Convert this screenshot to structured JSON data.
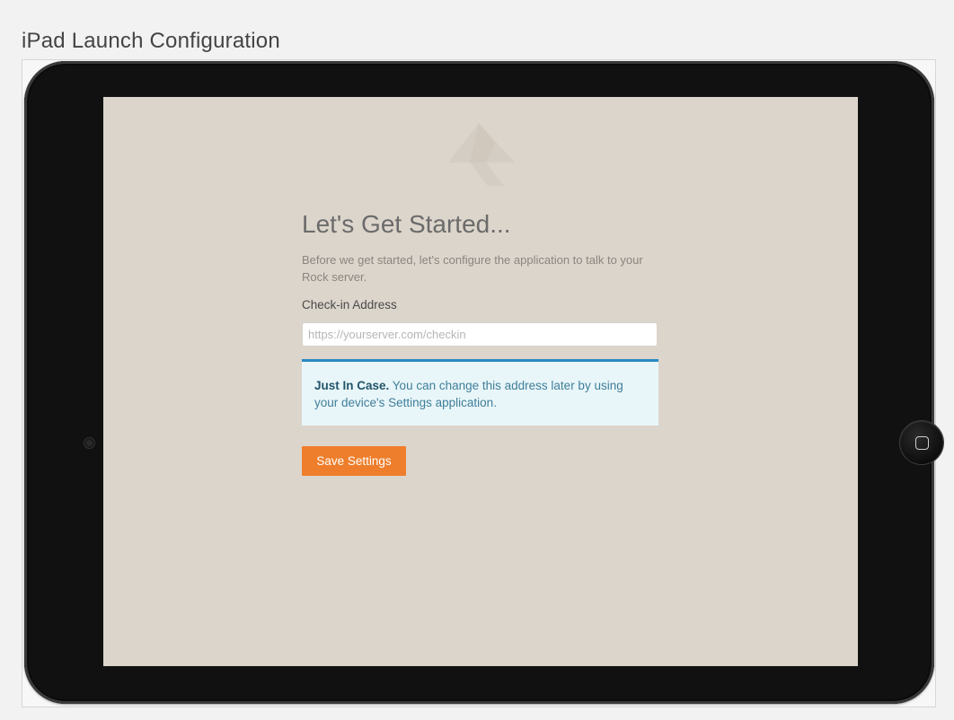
{
  "caption": "iPad Launch Configuration",
  "screen": {
    "logo_icon": "rock-logo-icon",
    "heading": "Let's Get Started...",
    "intro": "Before we get started, let's configure the application to talk to your Rock server.",
    "checkin_label": "Check-in Address",
    "checkin_placeholder": "https://yourserver.com/checkin",
    "checkin_value": "",
    "alert": {
      "title": "Just In Case.",
      "message": "You can change this address later by using your device's Settings application."
    },
    "save_label": "Save Settings"
  },
  "device": {
    "camera_icon": "camera-icon",
    "home_button_icon": "home-button-icon"
  },
  "colors": {
    "screen_background": "#dcd5cb",
    "accent": "#ee7e2b",
    "alert_border": "#2a89c4",
    "alert_background": "#e9f6f9"
  }
}
